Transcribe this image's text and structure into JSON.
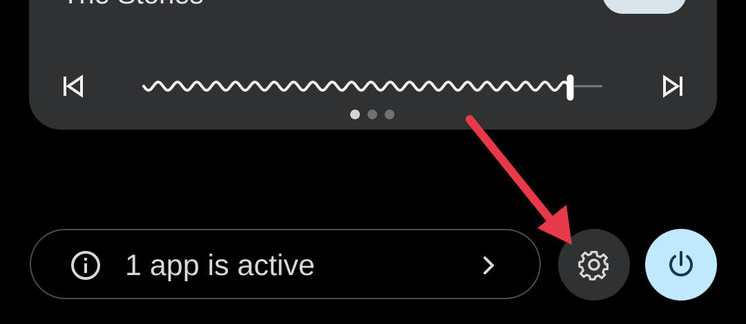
{
  "media": {
    "title": "The Stones",
    "controls": {
      "previous_icon": "skip-previous-icon",
      "next_icon": "skip-next-icon"
    },
    "progress": 0.93,
    "page_indicator": {
      "total": 3,
      "active_index": 0
    }
  },
  "status_chip": {
    "icon": "info-icon",
    "label": "1 app is active",
    "chevron_icon": "chevron-right-icon"
  },
  "settings_button": {
    "icon": "gear-icon"
  },
  "power_button": {
    "icon": "power-icon",
    "color": "#bfe9ff"
  },
  "annotation": {
    "type": "arrow",
    "color": "#e8394a"
  }
}
